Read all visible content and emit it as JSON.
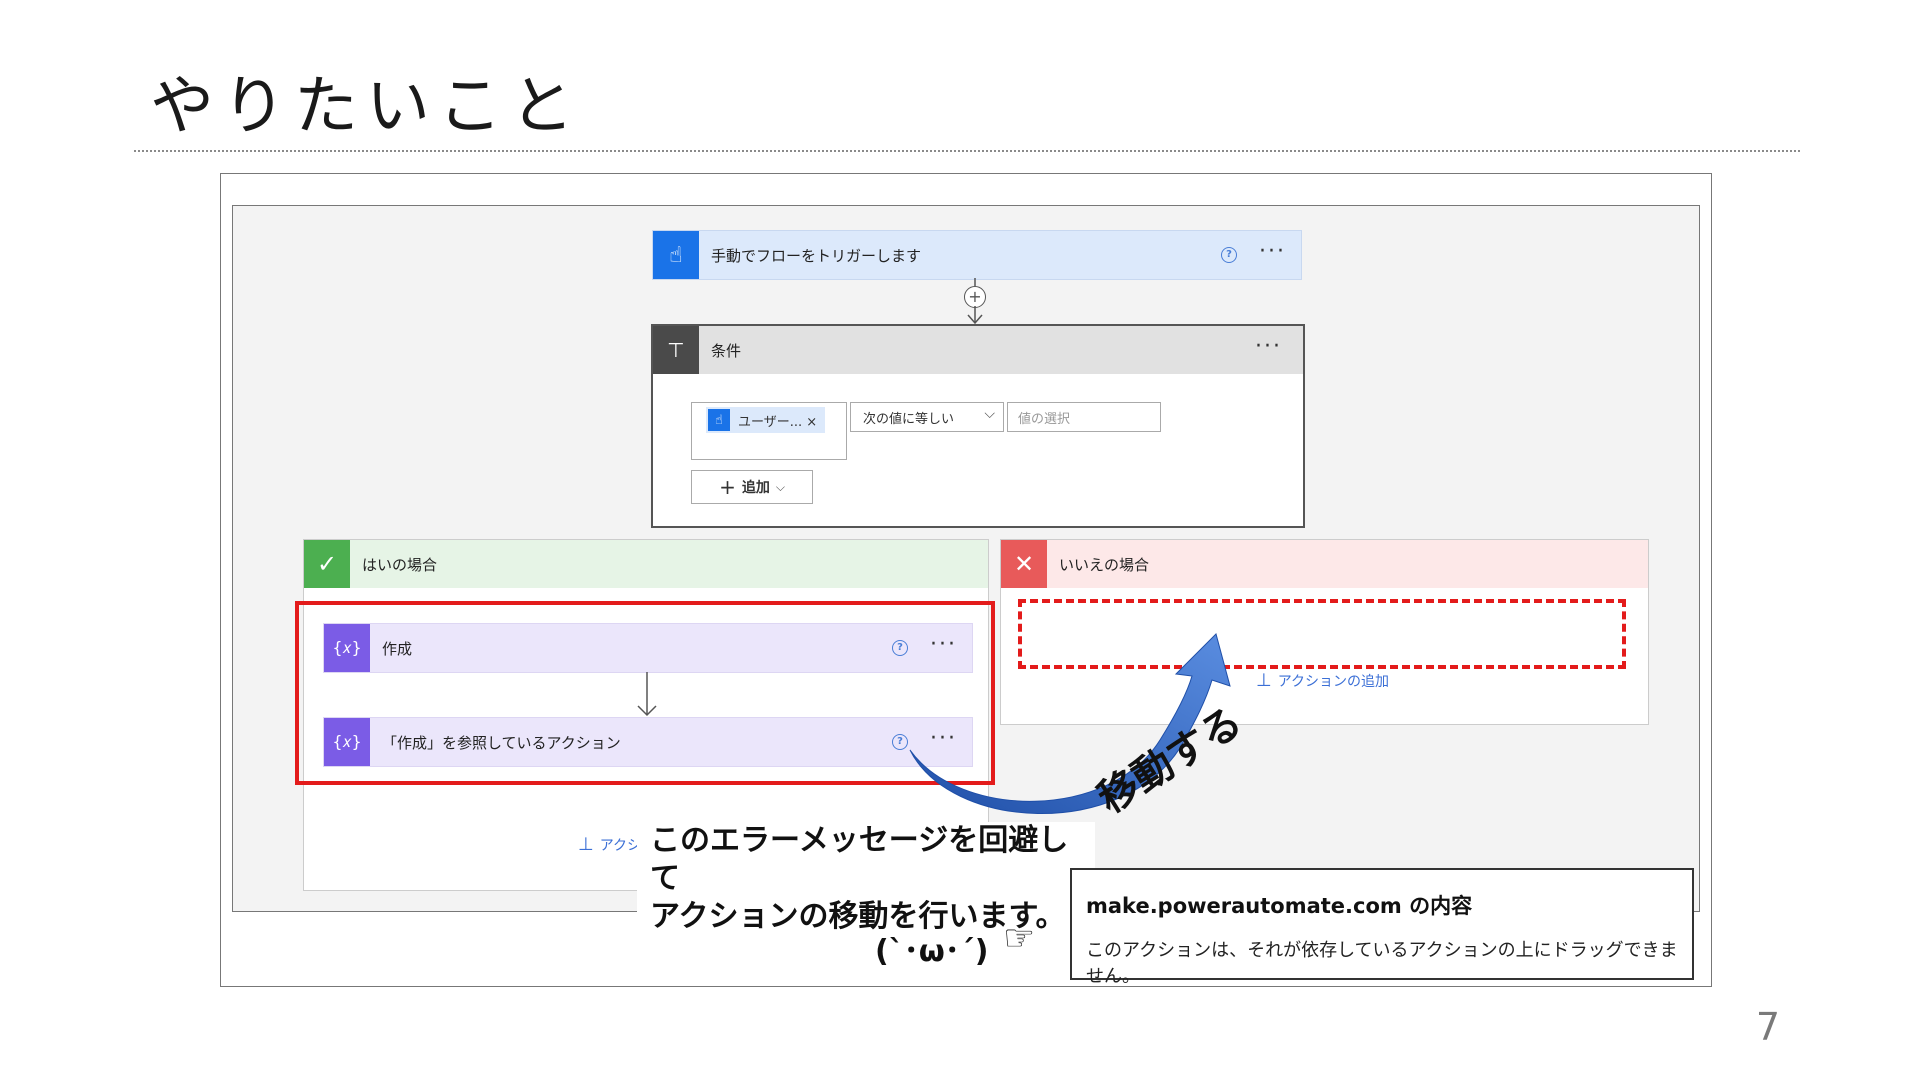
{
  "slide": {
    "title": "やりたいこと",
    "page_number": "7"
  },
  "flow": {
    "trigger": {
      "label": "手動でフローをトリガーします"
    },
    "condition": {
      "label": "条件",
      "token": "ユーザー... ×",
      "operator": "次の値に等しい",
      "value_placeholder": "値の選択",
      "add_label": "追加"
    },
    "yes_branch": {
      "label": "はいの場合",
      "action1": "作成",
      "action2": "「作成」を参照しているアクション",
      "add_action_partial": "アクシ"
    },
    "no_branch": {
      "label": "いいえの場合",
      "add_action": "アクションの追加"
    }
  },
  "annotation": {
    "move_label": "移動する",
    "note_line1": "このエラーメッセージを回避して",
    "note_line2": "アクションの移動を行います。",
    "kaomoji": "(`･ω･´)",
    "pointer": "☞"
  },
  "dialog": {
    "title": "make.powerautomate.com の内容",
    "message": "このアクションは、それが依存しているアクションの上にドラッグできません。"
  },
  "colors": {
    "trigger_blue": "#1a73e8",
    "compose_purple": "#7b5ce6",
    "yes_green": "#4caf50",
    "no_red": "#e85a5a",
    "highlight_red": "#e31b1b",
    "arrow_blue": "#2b5fb8"
  }
}
